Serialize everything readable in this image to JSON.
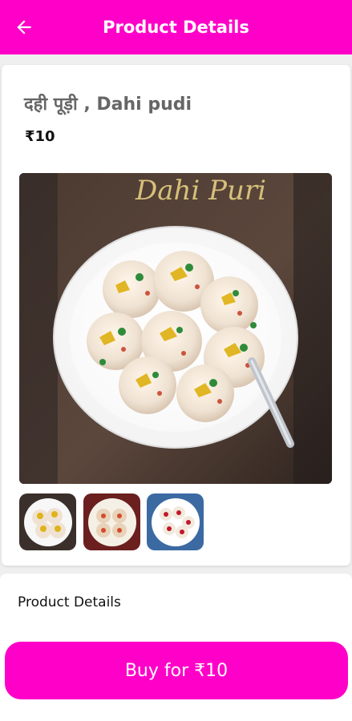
{
  "header": {
    "title": "Product Details",
    "back_icon": "arrow-left-icon",
    "background_color": "#ff00c8"
  },
  "product": {
    "name": "दही पूड़ी , Dahi pudi",
    "price": "₹10",
    "image_caption": "Dahi Puri",
    "thumbnails": [
      "thumbnail-1",
      "thumbnail-2",
      "thumbnail-3"
    ]
  },
  "details_section": {
    "title": "Product Details"
  },
  "actions": {
    "buy_label": "Buy for ₹10",
    "accent_color": "#ff00c8"
  }
}
